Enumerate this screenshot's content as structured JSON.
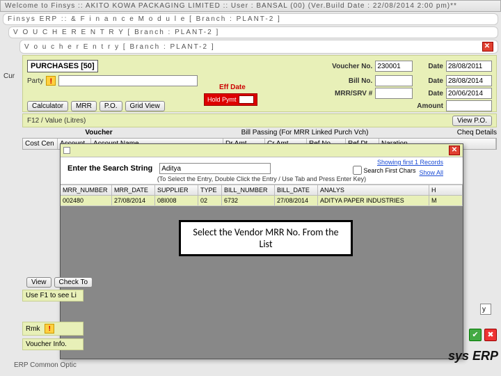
{
  "titlebar": "Welcome to Finsys :: AKITO KOWA PACKAGING LIMITED :: User : BANSAL (00) (Ver.Build Date : 22/08/2014 2:00 pm)**",
  "sub1": "Finsys ERP :: & F i n a n c e   M o d u l e      [ Branch : PLANT-2 ]",
  "sub2": "V O U C H E R   E N T R Y      [ Branch : PLANT-2 ]",
  "sub3": "V o u c h e r   E n t r y      [ Branch : PLANT-2 ]",
  "form": {
    "header": "PURCHASES  [50]",
    "voucher_no_lbl": "Voucher No.",
    "voucher_no": "230001",
    "date_lbl": "Date",
    "date1": "28/08/2011",
    "party_lbl": "Party",
    "bill_no_lbl": "Bill No.",
    "date2": "28/08/2014",
    "mrr_srv_lbl": "MRR/SRV #",
    "date3": "20/06/2014",
    "calc_btn": "Calculator",
    "mrr_btn": "MRR",
    "po_btn": "P.O.",
    "grid_btn": "Grid View",
    "eff_date": "Eff Date",
    "red_btn": "Hold Pymt",
    "amount_lbl": "Amount",
    "viewpo_btn": "View P.O.",
    "fn_lbl": "F12 / Value (Litres)",
    "cur_lbl": "Cur",
    "voucher_section": "Voucher",
    "bill_section": "Bill Passing (For MRR Linked Purch Vch)",
    "cheq_section": "Cheq Details"
  },
  "grid": {
    "c1": "Cost Cen",
    "c2": "Account",
    "c3": "Account Name",
    "c4": "Dr.Amt",
    "c5": "Cr.Amt",
    "c6": "Ref.No.",
    "c7": "Ref.Dt.",
    "c8": "Naration"
  },
  "footer": {
    "view_btn": "View",
    "check_btn": "Check To",
    "f1_hint": "Use F1 to see Li",
    "rmk_lbl": "Rmk",
    "vinfo_lbl": "Voucher Info.",
    "erp_lbl": "ERP Common Optic"
  },
  "search": {
    "title": "Enter the Search String",
    "value": "Aditya",
    "showing": "Showing first 1 Records",
    "first_chars": "Search First Chars",
    "show_all": "Show All",
    "hint": "(To Select the Entry, Double Click the Entry / Use Tab and Press Enter Key)",
    "h1": "MRR_NUMBER",
    "h2": "MRR_DATE",
    "h3": "SUPPLIER",
    "h4": "TYPE",
    "h5": "BILL_NUMBER",
    "h6": "BILL_DATE",
    "h7": "ANALYS",
    "r1": "002480",
    "r2": "27/08/2014",
    "r3": "08I008",
    "r4": "02",
    "r5": "6732",
    "r6": "27/08/2014",
    "r7": "ADITYA PAPER INDUSTRIES",
    "r8": "M",
    "r9": "H"
  },
  "callout": "Select  the Vendor MRR No. From the List",
  "brand": "sys ERP"
}
